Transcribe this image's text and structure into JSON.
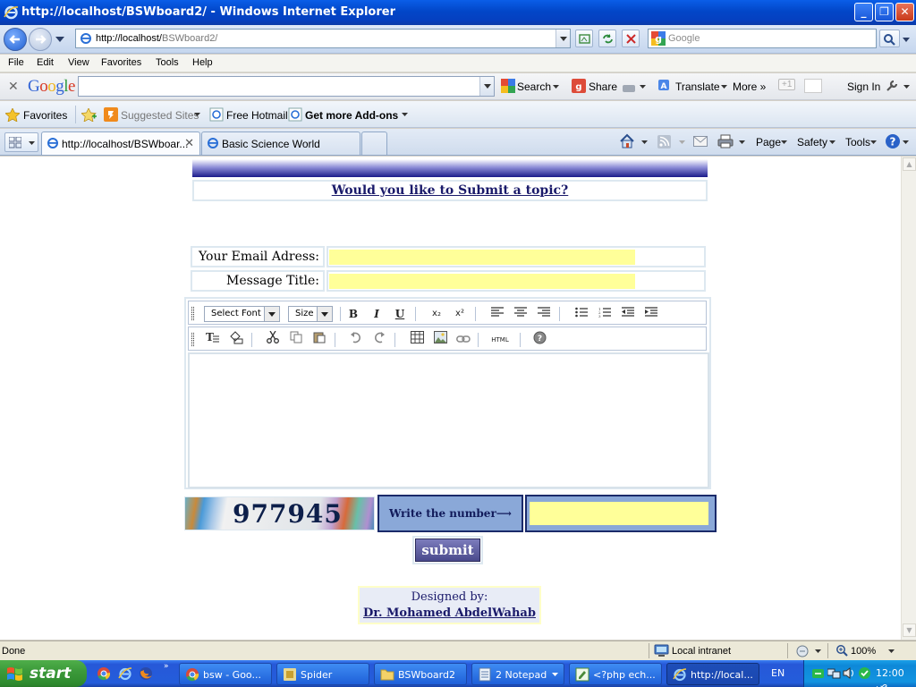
{
  "window": {
    "title": "http://localhost/BSWboard2/ - Windows Internet Explorer",
    "controls": {
      "minimize": "_",
      "maximize": "❐",
      "close": "✕"
    }
  },
  "address_bar": {
    "url_prefix": "http://localhost/",
    "url_path": "BSWboard2/",
    "search_placeholder": "Google"
  },
  "menu": [
    "File",
    "Edit",
    "View",
    "Favorites",
    "Tools",
    "Help"
  ],
  "google_toolbar": {
    "close": "✕",
    "logo_letters": [
      "G",
      "o",
      "o",
      "g",
      "l",
      "e"
    ],
    "logo_colors": [
      "#3465d6",
      "#d83a26",
      "#efb41c",
      "#3465d6",
      "#2f9a3e",
      "#d83a26"
    ],
    "search": "Search",
    "share": "Share",
    "translate": "Translate",
    "more": "More »",
    "plus_one": "+1",
    "sign_in": "Sign In"
  },
  "favorites_bar": {
    "favorites": "Favorites",
    "suggested_sites": "Suggested Sites",
    "free_hotmail": "Free Hotmail",
    "get_more_addons": "Get more Add-ons"
  },
  "tabs": [
    {
      "label": "http://localhost/BSWboar...",
      "active": true
    },
    {
      "label": "Basic Science World",
      "active": false
    }
  ],
  "command_bar": {
    "page": "Page",
    "safety": "Safety",
    "tools": "Tools"
  },
  "page": {
    "topic_link": "Would you like to Submit a topic?",
    "email_label": "Your Email Adress:",
    "email_value": "",
    "title_label": "Message Title:",
    "title_value": "",
    "editor": {
      "font_select": "Select Font",
      "size_select": "Size",
      "bold": "B",
      "italic": "I",
      "underline": "U",
      "subscript": "x₂",
      "superscript": "x²",
      "html_button": "HTML",
      "help": "?"
    },
    "captcha_number": "977945",
    "write_number": "Write the number⟶",
    "captcha_value": "",
    "submit": "submit",
    "designed_by": "Designed by:",
    "designer_name": "Dr. Mohamed AbdelWahab"
  },
  "status_bar": {
    "left": "Done",
    "zone": "Local intranet",
    "zoom": "100%"
  },
  "taskbar": {
    "start": "start",
    "tasks": [
      {
        "label": "bsw - Goo...",
        "icon": "chrome-icon",
        "active": false
      },
      {
        "label": "Spider",
        "icon": "spider-icon",
        "active": false
      },
      {
        "label": "BSWboard2",
        "icon": "folder-icon",
        "active": false
      },
      {
        "label": "2 Notepad",
        "icon": "notepad-icon",
        "active": false
      },
      {
        "label": "<?php ech...",
        "icon": "editor-icon",
        "active": false
      },
      {
        "label": "http://local...",
        "icon": "ie-icon",
        "active": true
      }
    ],
    "language": "EN",
    "clock": "12:00 ص"
  }
}
